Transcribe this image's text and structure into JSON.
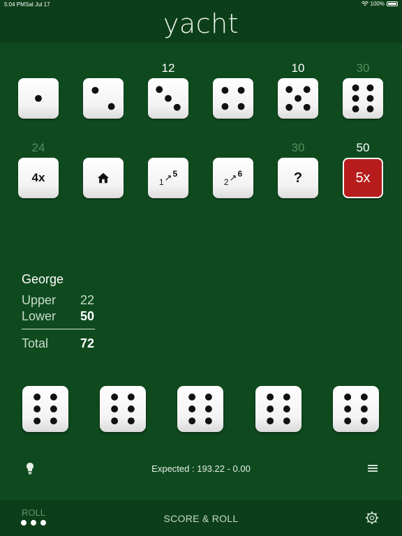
{
  "status_bar": {
    "time": "5:04 PM",
    "date": "Sat Jul 17",
    "battery": "100%"
  },
  "app": {
    "title": "yacht"
  },
  "upper_section": [
    {
      "category": "ones",
      "face": 1,
      "score": "",
      "score_state": "none"
    },
    {
      "category": "twos",
      "face": 2,
      "score": "",
      "score_state": "none"
    },
    {
      "category": "threes",
      "face": 3,
      "score": "12",
      "score_state": "filled"
    },
    {
      "category": "fours",
      "face": 4,
      "score": "",
      "score_state": "none"
    },
    {
      "category": "fives",
      "face": 5,
      "score": "10",
      "score_state": "filled"
    },
    {
      "category": "sixes",
      "face": 6,
      "score": "30",
      "score_state": "potential"
    }
  ],
  "lower_section": [
    {
      "category": "four-of-a-kind",
      "label": "4x",
      "score": "24",
      "score_state": "potential",
      "selected": false
    },
    {
      "category": "full-house",
      "label": "",
      "icon": "house-icon",
      "score": "",
      "score_state": "none",
      "selected": false
    },
    {
      "category": "small-straight",
      "label": "1↗5",
      "score": "",
      "score_state": "none",
      "selected": false
    },
    {
      "category": "large-straight",
      "label": "2↗6",
      "score": "",
      "score_state": "none",
      "selected": false
    },
    {
      "category": "chance",
      "label": "?",
      "score": "30",
      "score_state": "potential",
      "selected": false
    },
    {
      "category": "yacht",
      "label": "5x",
      "score": "50",
      "score_state": "filled",
      "selected": true
    }
  ],
  "player": {
    "name": "George",
    "upper_label": "Upper",
    "upper_value": "22",
    "lower_label": "Lower",
    "lower_value": "50",
    "total_label": "Total",
    "total_value": "72"
  },
  "roll_dice": [
    6,
    6,
    6,
    6,
    6
  ],
  "expected_text": "Expected : 193.22 - 0.00",
  "bottom_bar": {
    "roll_label": "ROLL",
    "rolls_remaining": 3,
    "score_roll_label": "SCORE & ROLL"
  },
  "colors": {
    "background": "#0f4a1f",
    "bar": "#0c3f19",
    "selected": "#b71c1c",
    "dim_text": "#4f8d5e"
  }
}
